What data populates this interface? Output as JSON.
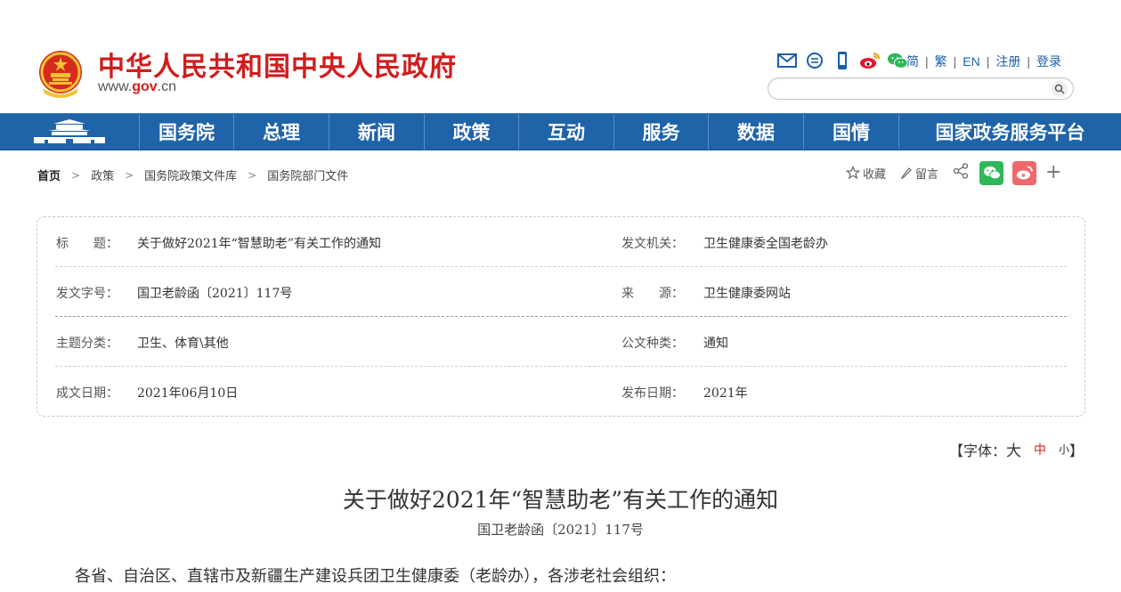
{
  "header": {
    "site_title": "中华人民共和国中央人民政府",
    "domain_prefix": "www.",
    "domain_main": "gov",
    "domain_suffix": ".cn",
    "icons": [
      "mail-icon",
      "chat-icon",
      "mobile-icon",
      "weibo-icon",
      "wechat-icon"
    ],
    "languages": [
      "简",
      "繁",
      "EN"
    ],
    "register": "注册",
    "login": "登录",
    "search_placeholder": ""
  },
  "nav": {
    "items": [
      "国务院",
      "总理",
      "新闻",
      "政策",
      "互动",
      "服务",
      "数据",
      "国情",
      "国家政务服务平台"
    ]
  },
  "breadcrumb": {
    "items": [
      "首页",
      "政策",
      "国务院政策文件库",
      "国务院部门文件"
    ]
  },
  "share": {
    "favorite": "收藏",
    "comment": "留言",
    "plus": "+"
  },
  "info": {
    "title_label": "标　　题：",
    "title_value": "关于做好2021年“智慧助老”有关工作的通知",
    "issuer_label": "发文机关：",
    "issuer_value": "卫生健康委全国老龄办",
    "docno_label": "发文字号：",
    "docno_value": "国卫老龄函〔2021〕117号",
    "source_label": "来　　源：",
    "source_value": "卫生健康委网站",
    "category_label": "主题分类：",
    "category_value": "卫生、体育\\其他",
    "doctype_label": "公文种类：",
    "doctype_value": "通知",
    "date_label": "成文日期：",
    "date_value": "2021年06月10日",
    "pub_label": "发布日期：",
    "pub_value": "2021年"
  },
  "fontsize": {
    "prefix": "【字体：",
    "big": "大",
    "mid": "中",
    "small": "小",
    "suffix": "】"
  },
  "article": {
    "title": "关于做好2021年“智慧助老”有关工作的通知",
    "doc_no": "国卫老龄函〔2021〕117号",
    "first_para": "各省、自治区、直辖市及新疆生产建设兵团卫生健康委（老龄办），各涉老社会组织："
  },
  "colors": {
    "brand_red": "#d11d1d",
    "nav_blue": "#1f63a8",
    "link_blue": "#1a5fa8",
    "wechat_green": "#2fb85a",
    "weibo_red": "#f0696a"
  }
}
